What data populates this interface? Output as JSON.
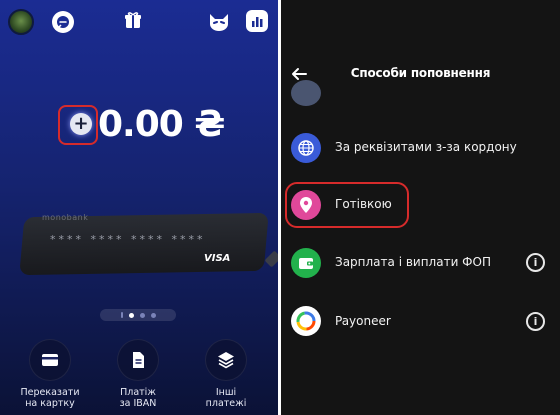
{
  "left_screen": {
    "balance": "0.00 ₴",
    "topup_icon": "+",
    "card": {
      "brand": "monobank",
      "number_mask": "**** **** **** ****",
      "network": "VISA"
    },
    "pagination": {
      "pages": 3,
      "active": 1
    },
    "actions": [
      {
        "label_line1": "Переказати",
        "label_line2": "на картку",
        "icon": "card-icon"
      },
      {
        "label_line1": "Платіж",
        "label_line2": "за IBAN",
        "icon": "document-icon"
      },
      {
        "label_line1": "Інші",
        "label_line2": "платежі",
        "icon": "layers-icon"
      }
    ],
    "toolbar_icons": [
      "avatar",
      "chat-icon",
      "gift-icon",
      "cat-icon",
      "stats-icon"
    ]
  },
  "right_screen": {
    "title": "Способи поповнення",
    "items": [
      {
        "label": "За реквізитами з-за кордону",
        "icon": "globe-icon",
        "color": "#3a5bd8",
        "info": false
      },
      {
        "label": "Готівкою",
        "icon": "location-pin-icon",
        "color": "#e0489a",
        "info": false
      },
      {
        "label": "Зарплата і виплати ФОП",
        "icon": "wallet-icon",
        "color": "#22b14c",
        "info": true,
        "info_text": "i"
      },
      {
        "label": "Payoneer",
        "icon": "payoneer-icon",
        "color": "#ffffff",
        "info": true,
        "info_text": "i"
      }
    ]
  },
  "colors": {
    "highlight": "#d62b2b",
    "left_bg": "#1b2c93",
    "right_bg": "#141414"
  }
}
